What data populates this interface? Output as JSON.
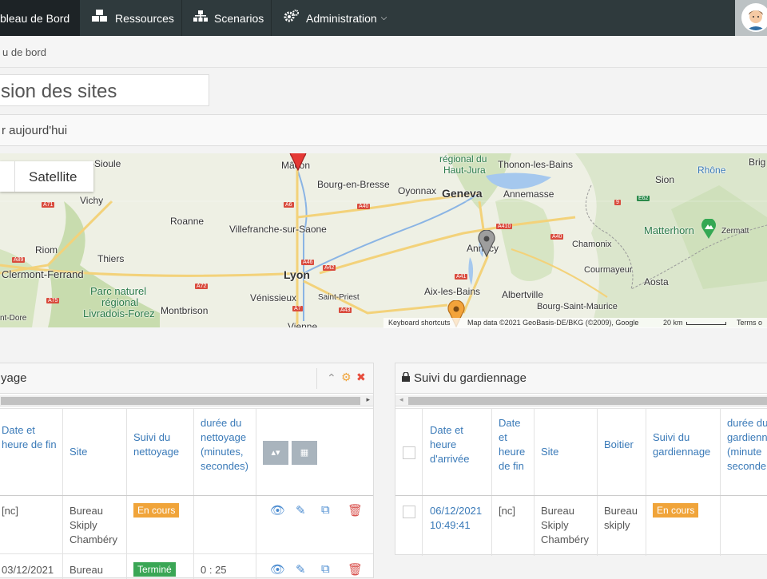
{
  "navbar": {
    "items": [
      {
        "label": "bleau de Bord",
        "icon": "dashboard-icon"
      },
      {
        "label": "Ressources",
        "icon": "cubes-icon"
      },
      {
        "label": "Scenarios",
        "icon": "sitemap-icon"
      },
      {
        "label": "Administration",
        "icon": "cogs-icon"
      }
    ]
  },
  "breadcrumb": "u de bord",
  "page_title": "sion des sites",
  "section_title": "r aujourd'hui",
  "map": {
    "satellite_label": "Satellite",
    "labels": [
      "Mâcon",
      "Bourg-en-Bresse",
      "Oyonnax",
      "Geneva",
      "Annemasse",
      "Thonon-les-Bains",
      "régional du",
      "Haut-Jura",
      "Sion",
      "Rhône",
      "Brig",
      "Vichy",
      "Roanne",
      "Villefranche-sur-Saone",
      "Riom",
      "Thiers",
      "Clermont-Ferrand",
      "Lyon",
      "Vénissieux",
      "Saint-Priest",
      "Vienne",
      "Parc naturel",
      "régional",
      "Livradois-Forez",
      "Montbrison",
      "Annecy",
      "Aix-les-Bains",
      "Albertville",
      "Bourg-Saint-Maurice",
      "Chamonix",
      "Courmayeur",
      "Aosta",
      "Matterhorn",
      "Zermatt",
      "r-Sioule",
      "nt-Dore"
    ],
    "roads": [
      "A71",
      "A6",
      "A40",
      "A410",
      "A40",
      "A89",
      "A72",
      "A46",
      "A42",
      "A7",
      "A43",
      "A75",
      "A41",
      "E62",
      "9"
    ],
    "footer": {
      "shortcuts": "Keyboard shortcuts",
      "data": "Map data ©2021 GeoBasis-DE/BKG (©2009), Google",
      "scale": "20 km",
      "terms": "Terms o"
    }
  },
  "panel_left": {
    "title": "yage",
    "headers": [
      "Date et heure de fin",
      "Site",
      "Suivi du nettoyage",
      "durée du nettoyage (minutes, secondes)"
    ],
    "rows": [
      {
        "date": "[nc]",
        "site": "Bureau Skiply Chambéry",
        "status": "En cours",
        "duration": ""
      },
      {
        "date": "03/12/2021",
        "site": "Bureau",
        "status": "Terminé",
        "duration": "0 : 25"
      }
    ]
  },
  "panel_right": {
    "title": "Suivi du gardiennage",
    "headers": [
      "Date et heure d'arrivée",
      "Date et heure de fin",
      "Site",
      "Boitier",
      "Suivi du gardiennage",
      "durée du gardienn (minute seconde"
    ],
    "rows": [
      {
        "arrival": "06/12/2021 10:49:41",
        "end": "[nc]",
        "site": "Bureau Skiply Chambéry",
        "box": "Bureau skiply",
        "status": "En cours"
      }
    ]
  }
}
